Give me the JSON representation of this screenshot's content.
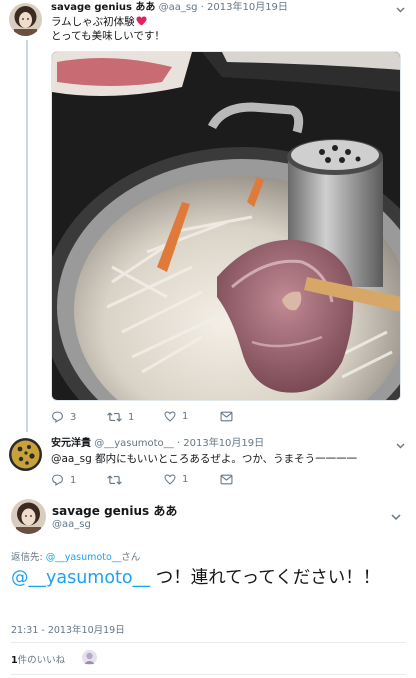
{
  "tweet1": {
    "name": "savage genius ああ",
    "handle": "@aa_sg",
    "separator": "·",
    "date": "2013年10月19日",
    "text_line1": "ラムしゃぶ初体験",
    "text_line2": "とっても美味しいです！",
    "reply_count": "3",
    "retweet_count": "1",
    "like_count": "1",
    "heart_color": "#e0245e"
  },
  "tweet2": {
    "name": "安元洋貴",
    "handle": "@__yasumoto__",
    "separator": "·",
    "date": "2013年10月19日",
    "text": "@aa_sg 都内にもいいところあるぜよ。つか、うまそう一一一一",
    "reply_count": "1",
    "retweet_count": "",
    "like_count": "1"
  },
  "main": {
    "name": "savage genius ああ",
    "handle": "@aa_sg",
    "reply_to_label": "返信先:",
    "reply_to_user": "@__yasumoto__",
    "reply_to_suffix": "さん",
    "mention": "@__yasumoto__",
    "text": " つ！連れてってください！！",
    "timestamp": "21:31 - 2013年10月19日",
    "likes_count": "1",
    "likes_label": "件のいいね"
  },
  "colors": {
    "accent": "#1da1f2",
    "secondary_text": "#657786",
    "divider": "#e6ecf0"
  },
  "icons": {
    "reply": "reply-icon",
    "retweet": "retweet-icon",
    "like": "like-icon",
    "dm": "direct-message-icon",
    "caret": "chevron-down-icon"
  }
}
